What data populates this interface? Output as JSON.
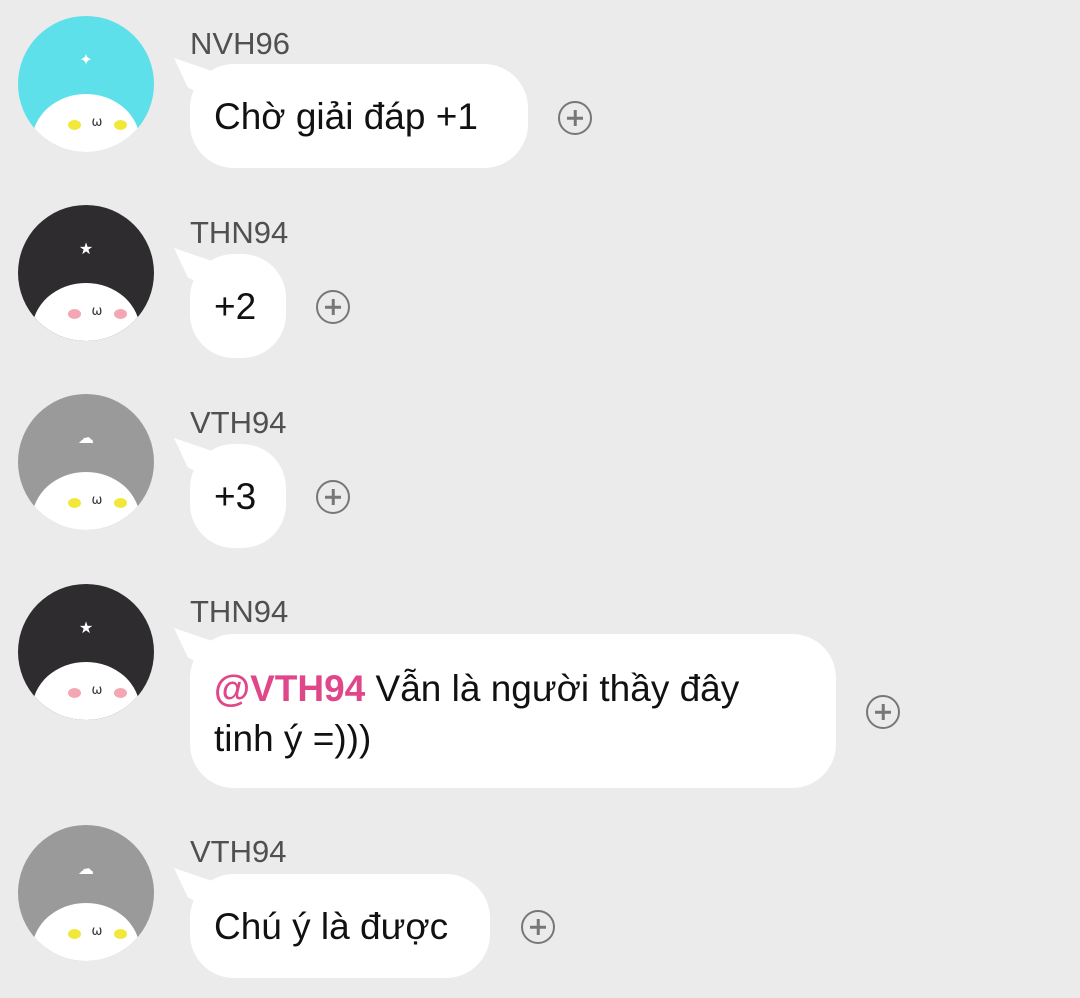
{
  "messages": [
    {
      "sender": "NVH96",
      "text": "Chờ giải đáp +1",
      "avatar_color": "#5de0ea",
      "avatar_icon": "sparkle-icon",
      "cheek_color": "#f1e83a"
    },
    {
      "sender": "THN94",
      "text": "+2",
      "avatar_color": "#2f2c30",
      "avatar_icon": "star-icon",
      "cheek_color": "#f4a6b4"
    },
    {
      "sender": "VTH94",
      "text": "+3",
      "avatar_color": "#9a9a9a",
      "avatar_icon": "cloud-rain-icon",
      "cheek_color": "#f1e83a"
    },
    {
      "sender": "THN94",
      "mention": "@VTH94",
      "text_line1": " Vẫn là người thầy đây",
      "text_line2": "tinh ý =)))",
      "avatar_color": "#2f2c30",
      "avatar_icon": "star-icon",
      "cheek_color": "#f4a6b4"
    },
    {
      "sender": "VTH94",
      "text": "Chú ý là được",
      "avatar_color": "#9a9a9a",
      "avatar_icon": "cloud-rain-icon",
      "cheek_color": "#f1e83a"
    }
  ],
  "icons": {
    "sparkle": "✦",
    "star": "★",
    "cloud": "☁",
    "mouth": "ω"
  },
  "colors": {
    "background": "#ebebec",
    "bubble": "#ffffff",
    "mention": "#e0478a",
    "sender": "#505050"
  }
}
